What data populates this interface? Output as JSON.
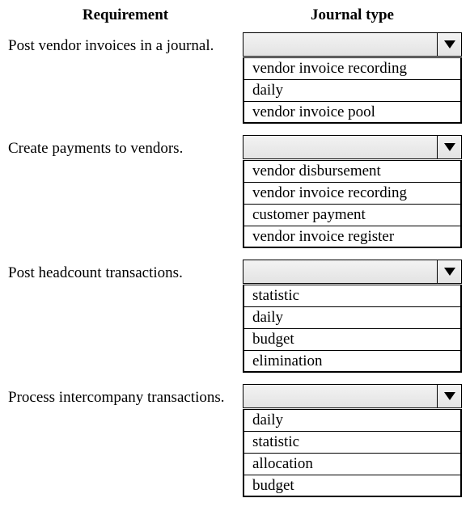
{
  "headers": {
    "left": "Requirement",
    "right": "Journal type"
  },
  "questions": [
    {
      "label": "Post vendor invoices in a journal.",
      "selected": "",
      "options": [
        "vendor invoice recording",
        "daily",
        "vendor invoice pool"
      ]
    },
    {
      "label": "Create payments to vendors.",
      "selected": "",
      "options": [
        "vendor disbursement",
        "vendor invoice recording",
        "customer payment",
        "vendor invoice register"
      ]
    },
    {
      "label": "Post headcount transactions.",
      "selected": "",
      "options": [
        "statistic",
        "daily",
        "budget",
        "elimination"
      ]
    },
    {
      "label": "Process intercompany transactions.",
      "selected": "",
      "options": [
        "daily",
        "statistic",
        "allocation",
        "budget"
      ]
    }
  ]
}
